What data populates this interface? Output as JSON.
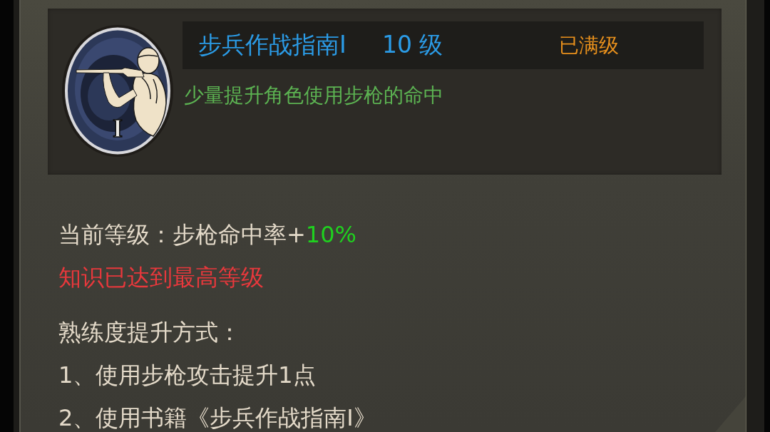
{
  "skill": {
    "badge": "I",
    "name": "步兵作战指南Ⅰ",
    "level": "10 级",
    "status": "已满级",
    "description": "少量提升角色使用步枪的命中"
  },
  "current_level": {
    "label": "当前等级：步枪命中率+",
    "value": "10%"
  },
  "notice": "知识已达到最高等级",
  "proficiency": {
    "title": "熟练度提升方式：",
    "methods": [
      "1、使用步枪攻击提升1点",
      "2、使用书籍《步兵作战指南Ⅰ》"
    ]
  }
}
